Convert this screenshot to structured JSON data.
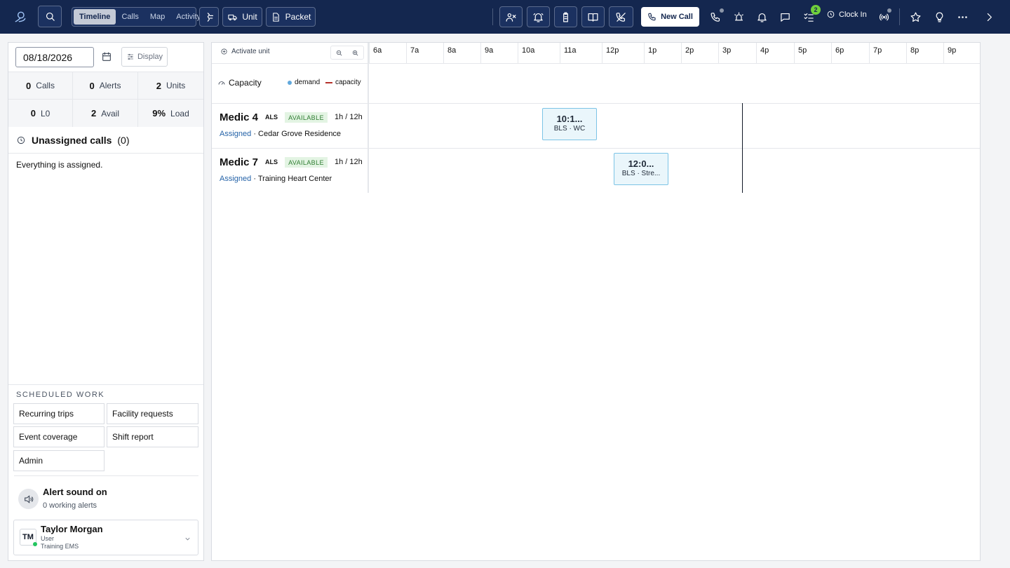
{
  "toolbar": {
    "views": [
      "Timeline",
      "Calls",
      "Map",
      "Activity"
    ],
    "active_view": "Timeline",
    "unit_label": "Unit",
    "packet_label": "Packet",
    "new_call_label": "New Call",
    "tasks_badge": "2",
    "clock_in_label": "Clock In"
  },
  "filters": {
    "date": "08/18/2026",
    "display_label": "Display"
  },
  "stats": [
    {
      "value": "0",
      "label": "Calls"
    },
    {
      "value": "0",
      "label": "Alerts"
    },
    {
      "value": "2",
      "label": "Units"
    },
    {
      "value": "0",
      "label": "L0"
    },
    {
      "value": "2",
      "label": "Avail"
    },
    {
      "value": "9%",
      "label": "Load"
    }
  ],
  "unassigned": {
    "title": "Unassigned calls",
    "count": "(0)",
    "empty_message": "Everything is assigned."
  },
  "scheduled": {
    "title": "SCHEDULED WORK",
    "buttons": [
      "Recurring trips",
      "Facility requests",
      "Event coverage",
      "Shift report",
      "Admin"
    ]
  },
  "alert_sound": {
    "title": "Alert sound on",
    "subtitle": "0 working alerts"
  },
  "user": {
    "initials": "TM",
    "name": "Taylor Morgan",
    "role": "User",
    "org": "Training EMS"
  },
  "timeline": {
    "activate_label": "Activate unit",
    "hours": [
      "6a",
      "7a",
      "8a",
      "9a",
      "10a",
      "11a",
      "12p",
      "1p",
      "2p",
      "3p",
      "4p",
      "5p",
      "6p",
      "7p",
      "8p",
      "9p"
    ],
    "capacity_label": "Capacity",
    "legend_demand": "demand",
    "legend_capacity": "capacity",
    "units": [
      {
        "name": "Medic 4",
        "level": "ALS",
        "status": "AVAILABLE",
        "hours": "1h / 12h",
        "assigned_label": "Assigned",
        "location": "Cedar Grove Residence",
        "event_time": "10:1...",
        "event_detail": "BLS · WC"
      },
      {
        "name": "Medic 7",
        "level": "ALS",
        "status": "AVAILABLE",
        "hours": "1h / 12h",
        "assigned_label": "Assigned",
        "location": "Training Heart Center",
        "event_time": "12:0...",
        "event_detail": "BLS · Stre..."
      }
    ]
  }
}
